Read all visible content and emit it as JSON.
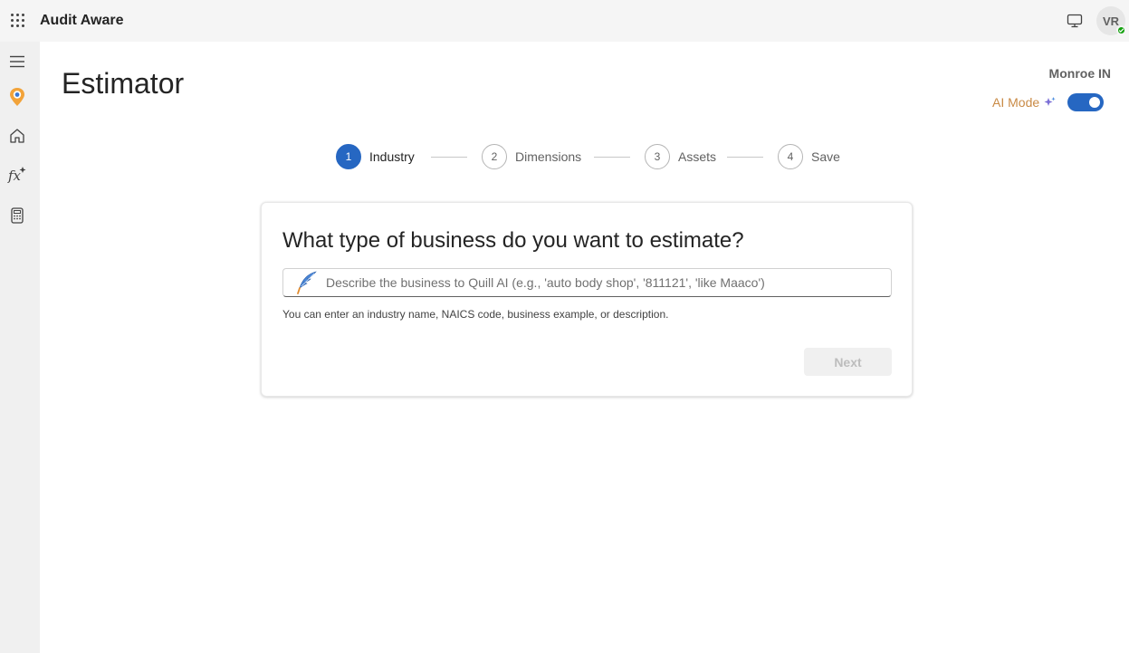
{
  "app": {
    "title": "Audit Aware",
    "user_initials": "VR"
  },
  "rail": {
    "items": [
      {
        "name": "hamburger-menu-icon"
      },
      {
        "name": "location-pin-icon"
      },
      {
        "name": "home-icon"
      },
      {
        "name": "function-sparkle-icon"
      },
      {
        "name": "calculator-icon"
      }
    ]
  },
  "header": {
    "page_title": "Estimator",
    "location": "Monroe IN",
    "ai_mode_label": "AI Mode",
    "ai_mode_on": true
  },
  "stepper": {
    "steps": [
      {
        "number": "1",
        "label": "Industry",
        "active": true
      },
      {
        "number": "2",
        "label": "Dimensions",
        "active": false
      },
      {
        "number": "3",
        "label": "Assets",
        "active": false
      },
      {
        "number": "4",
        "label": "Save",
        "active": false
      }
    ]
  },
  "card": {
    "title": "What type of business do you want to estimate?",
    "input_value": "",
    "input_placeholder": "Describe the business to Quill AI (e.g., 'auto body shop', '811121', 'like Maaco')",
    "hint": "You can enter an industry name, NAICS code, business example, or description.",
    "next_label": "Next"
  },
  "colors": {
    "accent": "#2667c2",
    "ai_label": "#c98a45",
    "presence": "#13a10e"
  }
}
